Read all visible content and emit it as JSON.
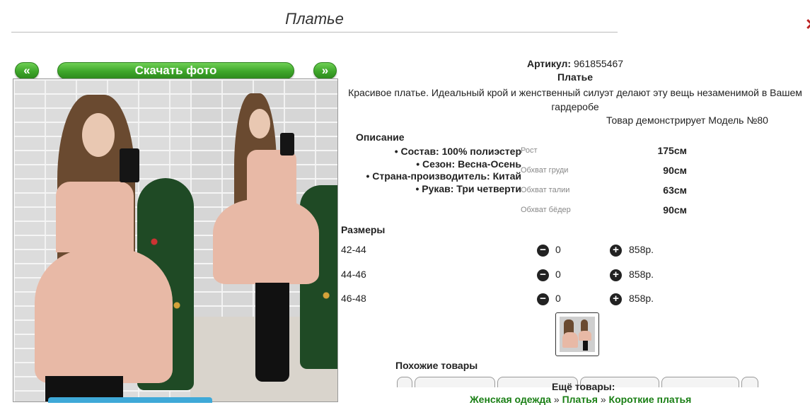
{
  "page": {
    "title": "Платье"
  },
  "gallery": {
    "prev_label": "«",
    "download_label": "Скачать фото",
    "next_label": "»"
  },
  "product": {
    "article_label": "Артикул:",
    "article_value": "961855467",
    "name": "Платье",
    "description": "Красивое платье. Идеальный крой и женственный силуэт делают эту вещь незаменимой в Вашем гардеробе",
    "model_note": "Товар демонстрирует Модель №80"
  },
  "specs": {
    "heading": "Описание",
    "items": [
      "Состав: 100% полиэстер",
      "Сезон: Весна-Осень",
      "Страна-производитель: Китай",
      "Рукав: Три четверти"
    ]
  },
  "measurements": [
    {
      "label": "Рост",
      "value": "175см"
    },
    {
      "label": "Обхват груди",
      "value": "90см"
    },
    {
      "label": "Обхват талии",
      "value": "63см"
    },
    {
      "label": "Обхват бёдер",
      "value": "90см"
    }
  ],
  "sizes": {
    "heading": "Размеры",
    "rows": [
      {
        "size": "42-44",
        "qty": "0",
        "price": "858р."
      },
      {
        "size": "44-46",
        "qty": "0",
        "price": "858р."
      },
      {
        "size": "46-48",
        "qty": "0",
        "price": "858р."
      }
    ]
  },
  "similar": {
    "heading": "Похожие товары"
  },
  "more": {
    "heading": "Ещё товары:",
    "breadcrumbs": [
      "Женская одежда",
      "Платья",
      "Короткие платья"
    ],
    "separator": "»"
  },
  "colors": {
    "accent_green": "#3ea62a",
    "link_green": "#1a7f15",
    "icon_dark": "#222222"
  },
  "icons": {
    "minus": "minus-circle-icon",
    "plus": "plus-circle-icon"
  }
}
